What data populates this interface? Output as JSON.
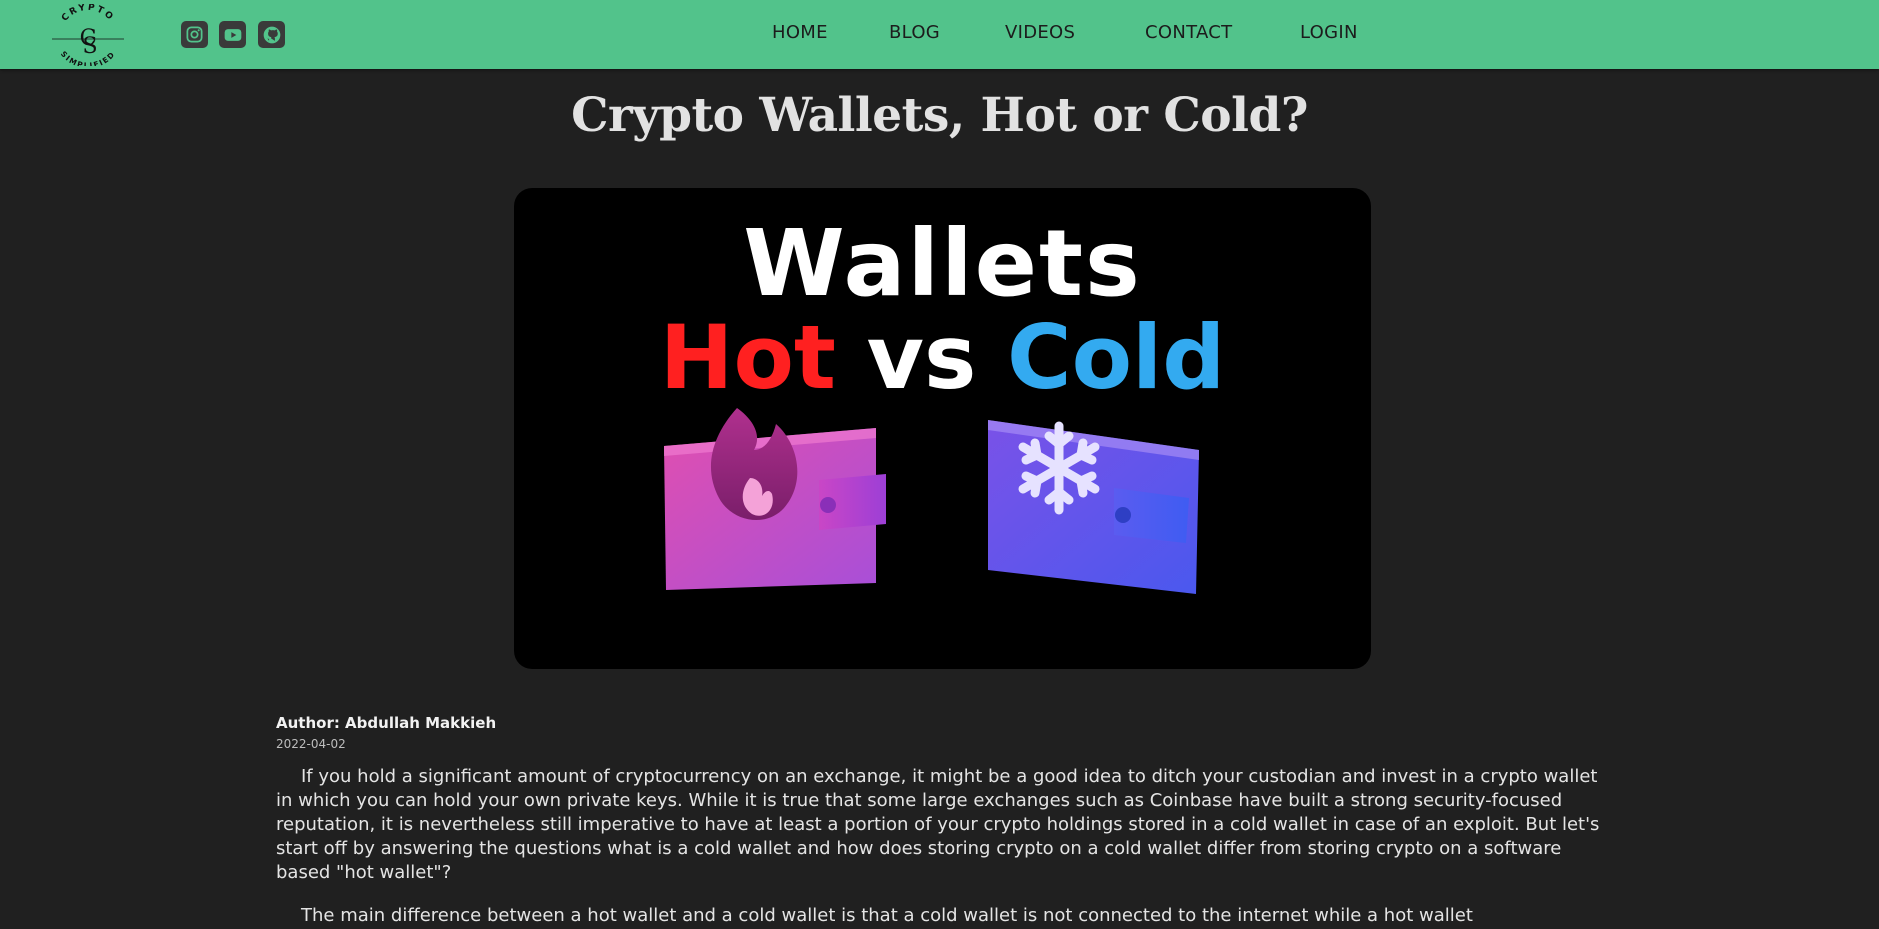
{
  "nav": {
    "logo_top": "CRYPTO",
    "logo_mark": "CS",
    "logo_bottom": "SIMPLIFIED",
    "social": [
      {
        "icon": "instagram-icon"
      },
      {
        "icon": "youtube-icon"
      },
      {
        "icon": "github-icon"
      }
    ],
    "links": [
      "HOME",
      "BLOG",
      "VIDEOS",
      "CONTACT",
      "LOGIN"
    ],
    "background": "#52c38b"
  },
  "article": {
    "title": "Crypto Wallets, Hot or Cold?",
    "hero": {
      "line1": "Wallets",
      "hot": "Hot",
      "vs": "vs",
      "cold": "Cold",
      "hot_color": "#ff2020",
      "cold_color": "#33aaf0"
    },
    "author": "Author: Abdullah Makkieh",
    "date": "2022-04-02",
    "paragraphs": [
      "If you hold a significant amount of cryptocurrency on an exchange, it might be a good idea to ditch your custodian and invest in a crypto wallet in which you can hold your own private keys. While it is true that some large exchanges such as Coinbase have built a strong security-focused reputation, it is nevertheless still imperative to have at least a portion of your crypto holdings stored in a cold wallet in case of an exploit. But let's start off by answering the questions what is a cold wallet and how does storing crypto on a cold wallet differ from storing crypto on a software based \"hot wallet\"?",
      "The main difference between a hot wallet and a cold wallet is that a cold wallet is not connected to the internet while a hot wallet"
    ]
  },
  "colors": {
    "page_background": "#202020",
    "text": "#e4e4e4"
  }
}
